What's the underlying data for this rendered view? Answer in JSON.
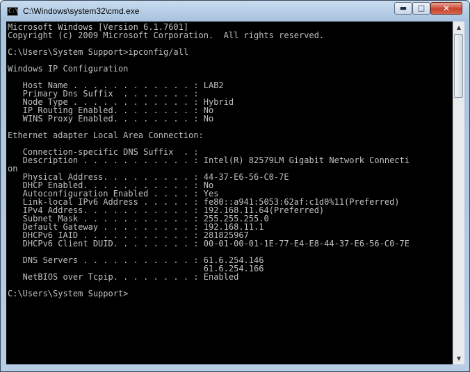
{
  "window": {
    "title": "C:\\Windows\\system32\\cmd.exe",
    "icon": "cmd-icon",
    "controls": {
      "minimize": "minimize-icon",
      "maximize": "maximize-icon",
      "close": "close-icon"
    }
  },
  "console": {
    "lines": [
      "Microsoft Windows [Version 6.1.7601]",
      "Copyright (c) 2009 Microsoft Corporation.  All rights reserved.",
      "",
      "C:\\Users\\System Support>ipconfig/all",
      "",
      "Windows IP Configuration",
      "",
      "   Host Name . . . . . . . . . . . . : LAB2",
      "   Primary Dns Suffix  . . . . . . . :",
      "   Node Type . . . . . . . . . . . . : Hybrid",
      "   IP Routing Enabled. . . . . . . . : No",
      "   WINS Proxy Enabled. . . . . . . . : No",
      "",
      "Ethernet adapter Local Area Connection:",
      "",
      "   Connection-specific DNS Suffix  . :",
      "   Description . . . . . . . . . . . : Intel(R) 82579LM Gigabit Network Connecti",
      "on",
      "   Physical Address. . . . . . . . . : 44-37-E6-56-C0-7E",
      "   DHCP Enabled. . . . . . . . . . . : No",
      "   Autoconfiguration Enabled . . . . : Yes",
      "   Link-local IPv6 Address . . . . . : fe80::a941:5053:62af:c1d0%11(Preferred)",
      "   IPv4 Address. . . . . . . . . . . : 192.168.11.64(Preferred)",
      "   Subnet Mask . . . . . . . . . . . : 255.255.255.0",
      "   Default Gateway . . . . . . . . . : 192.168.11.1",
      "   DHCPv6 IAID . . . . . . . . . . . : 281825967",
      "   DHCPv6 Client DUID. . . . . . . . : 00-01-00-01-1E-77-E4-E8-44-37-E6-56-C0-7E",
      "",
      "   DNS Servers . . . . . . . . . . . : 61.6.254.146",
      "                                       61.6.254.166",
      "   NetBIOS over Tcpip. . . . . . . . : Enabled",
      "",
      "C:\\Users\\System Support>"
    ]
  }
}
